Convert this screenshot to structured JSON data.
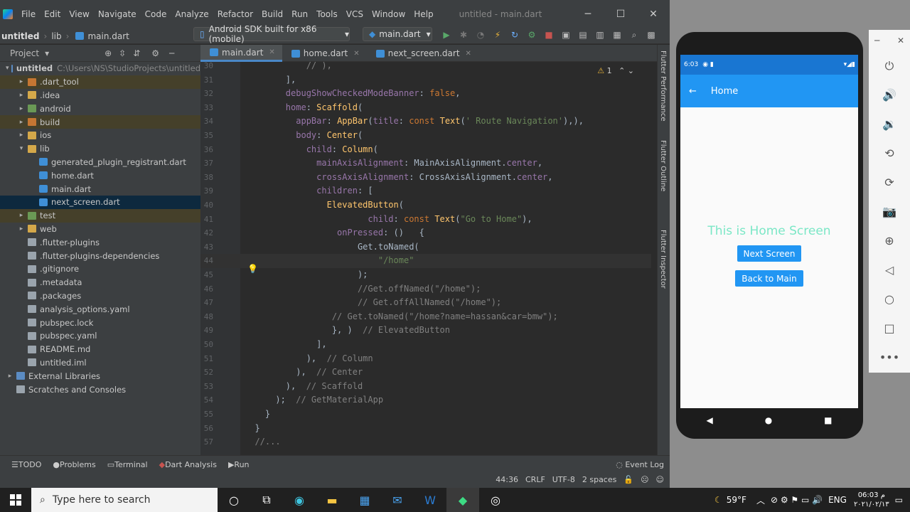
{
  "menu": {
    "items": [
      "File",
      "Edit",
      "View",
      "Navigate",
      "Code",
      "Analyze",
      "Refactor",
      "Build",
      "Run",
      "Tools",
      "VCS",
      "Window",
      "Help"
    ],
    "window_title": "untitled - main.dart"
  },
  "nav": {
    "project": "untitled",
    "lib": "lib",
    "file": "main.dart",
    "device": "Android SDK built for x86 (mobile)",
    "run_config": "main.dart"
  },
  "project_panel": {
    "title": "Project"
  },
  "tree": [
    {
      "label": "untitled",
      "path": "C:\\Users\\NS\\StudioProjects\\untitled",
      "indent": 0,
      "arrow": "▾",
      "icon": "folder blue",
      "bold": true
    },
    {
      "label": ".dart_tool",
      "indent": 1,
      "arrow": "▸",
      "icon": "folder orange",
      "style": "excl"
    },
    {
      "label": ".idea",
      "indent": 1,
      "arrow": "▸",
      "icon": "folder"
    },
    {
      "label": "android",
      "indent": 1,
      "arrow": "▸",
      "icon": "folder green"
    },
    {
      "label": "build",
      "indent": 1,
      "arrow": "▸",
      "icon": "folder orange",
      "style": "excl"
    },
    {
      "label": "ios",
      "indent": 1,
      "arrow": "▸",
      "icon": "folder"
    },
    {
      "label": "lib",
      "indent": 1,
      "arrow": "▾",
      "icon": "folder"
    },
    {
      "label": "generated_plugin_registrant.dart",
      "indent": 2,
      "arrow": "",
      "icon": "dart"
    },
    {
      "label": "home.dart",
      "indent": 2,
      "arrow": "",
      "icon": "dart"
    },
    {
      "label": "main.dart",
      "indent": 2,
      "arrow": "",
      "icon": "dart"
    },
    {
      "label": "next_screen.dart",
      "indent": 2,
      "arrow": "",
      "icon": "dart",
      "style": "sel"
    },
    {
      "label": "test",
      "indent": 1,
      "arrow": "▸",
      "icon": "folder green",
      "style": "excl"
    },
    {
      "label": "web",
      "indent": 1,
      "arrow": "▸",
      "icon": "folder"
    },
    {
      "label": ".flutter-plugins",
      "indent": 1,
      "arrow": "",
      "icon": "fileic"
    },
    {
      "label": ".flutter-plugins-dependencies",
      "indent": 1,
      "arrow": "",
      "icon": "fileic"
    },
    {
      "label": ".gitignore",
      "indent": 1,
      "arrow": "",
      "icon": "fileic"
    },
    {
      "label": ".metadata",
      "indent": 1,
      "arrow": "",
      "icon": "fileic"
    },
    {
      "label": ".packages",
      "indent": 1,
      "arrow": "",
      "icon": "fileic"
    },
    {
      "label": "analysis_options.yaml",
      "indent": 1,
      "arrow": "",
      "icon": "fileic"
    },
    {
      "label": "pubspec.lock",
      "indent": 1,
      "arrow": "",
      "icon": "fileic"
    },
    {
      "label": "pubspec.yaml",
      "indent": 1,
      "arrow": "",
      "icon": "fileic"
    },
    {
      "label": "README.md",
      "indent": 1,
      "arrow": "",
      "icon": "fileic"
    },
    {
      "label": "untitled.iml",
      "indent": 1,
      "arrow": "",
      "icon": "fileic"
    },
    {
      "label": "External Libraries",
      "indent": 0,
      "arrow": "▸",
      "icon": "folder blue"
    },
    {
      "label": "Scratches and Consoles",
      "indent": 0,
      "arrow": "",
      "icon": "fileic"
    }
  ],
  "tabs": [
    "main.dart",
    "home.dart",
    "next_screen.dart"
  ],
  "editor": {
    "warnings": "1"
  },
  "code": [
    {
      "n": "30",
      "h": "            <span class=\"c\">// ),</span>"
    },
    {
      "n": "31",
      "h": "        ],"
    },
    {
      "n": "32",
      "h": "        <span class=\"p\">debugShowCheckedModeBanner</span>: <span class=\"k\">false</span>,"
    },
    {
      "n": "33",
      "h": "        <span class=\"p\">home</span>: <span class=\"f\">Scaffold</span>("
    },
    {
      "n": "34",
      "h": "          <span class=\"p\">appBar</span>: <span class=\"f\">AppBar</span>(<span class=\"p\">title</span>: <span class=\"k\">const</span> <span class=\"f\">Text</span>(<span class=\"s\">' Route Navigation'</span>),),"
    },
    {
      "n": "35",
      "h": "          <span class=\"p\">body</span>: <span class=\"f\">Center</span>("
    },
    {
      "n": "36",
      "h": "            <span class=\"p\">child</span>: <span class=\"f\">Column</span>("
    },
    {
      "n": "37",
      "h": "              <span class=\"p\">mainAxisAlignment</span>: MainAxisAlignment.<span class=\"p\">center</span>,"
    },
    {
      "n": "38",
      "h": "              <span class=\"p\">crossAxisAlignment</span>: CrossAxisAlignment.<span class=\"p\">center</span>,"
    },
    {
      "n": "39",
      "h": "              <span class=\"p\">children</span>: ["
    },
    {
      "n": "40",
      "h": "                <span class=\"f\">ElevatedButton</span>("
    },
    {
      "n": "41",
      "h": "                        <span class=\"p\">child</span>: <span class=\"k\">const</span> <span class=\"f\">Text</span>(<span class=\"s\">\"Go to Home\"</span>),"
    },
    {
      "n": "42",
      "h": "                  <span class=\"p\">onPressed</span>: ()   {"
    },
    {
      "n": "43",
      "h": "                      Get.toNamed("
    },
    {
      "n": "44",
      "h": "                          <span class=\"s\">\"/home\"</span>",
      "cur": true
    },
    {
      "n": "45",
      "h": "                      );"
    },
    {
      "n": "46",
      "h": "                      <span class=\"c\">//Get.offNamed(\"/home\");</span>"
    },
    {
      "n": "47",
      "h": "                      <span class=\"c\">// Get.offAllNamed(\"/home\");</span>"
    },
    {
      "n": "48",
      "h": "                 <span class=\"c\">// Get.toNamed(\"/home?name=hassan&amp;car=bmw\");</span>"
    },
    {
      "n": "49",
      "h": "                 }, )  <span class=\"c\">// ElevatedButton</span>"
    },
    {
      "n": "50",
      "h": "              ],"
    },
    {
      "n": "51",
      "h": "            ),  <span class=\"c\">// Column</span>"
    },
    {
      "n": "52",
      "h": "          ),  <span class=\"c\">// Center</span>"
    },
    {
      "n": "53",
      "h": "        ),  <span class=\"c\">// Scaffold</span>"
    },
    {
      "n": "54",
      "h": "      );  <span class=\"c\">// GetMaterialApp</span>"
    },
    {
      "n": "55",
      "h": "    }"
    },
    {
      "n": "56",
      "h": "  }"
    },
    {
      "n": "57",
      "h": "  <span class=\"c\">//...</span>"
    }
  ],
  "side_tools": [
    "Flutter Performance",
    "Flutter Outline",
    "Flutter Inspector"
  ],
  "status": {
    "todo": "TODO",
    "problems": "Problems",
    "terminal": "Terminal",
    "dart_analysis": "Dart Analysis",
    "run": "Run",
    "event_log": "Event Log",
    "position": "44:36",
    "line_sep": "CRLF",
    "encoding": "UTF-8",
    "indent": "2 spaces"
  },
  "phone": {
    "time": "6:03",
    "appbar_title": "Home",
    "home_text": "This is Home Screen",
    "btn_next": "Next Screen",
    "btn_back": "Back to Main"
  },
  "taskbar": {
    "search_placeholder": "Type here to search",
    "weather": "59°F",
    "lang": "ENG",
    "clock": "06:03 م",
    "date": "۲۰۲۱/۰۲/۱۳"
  }
}
